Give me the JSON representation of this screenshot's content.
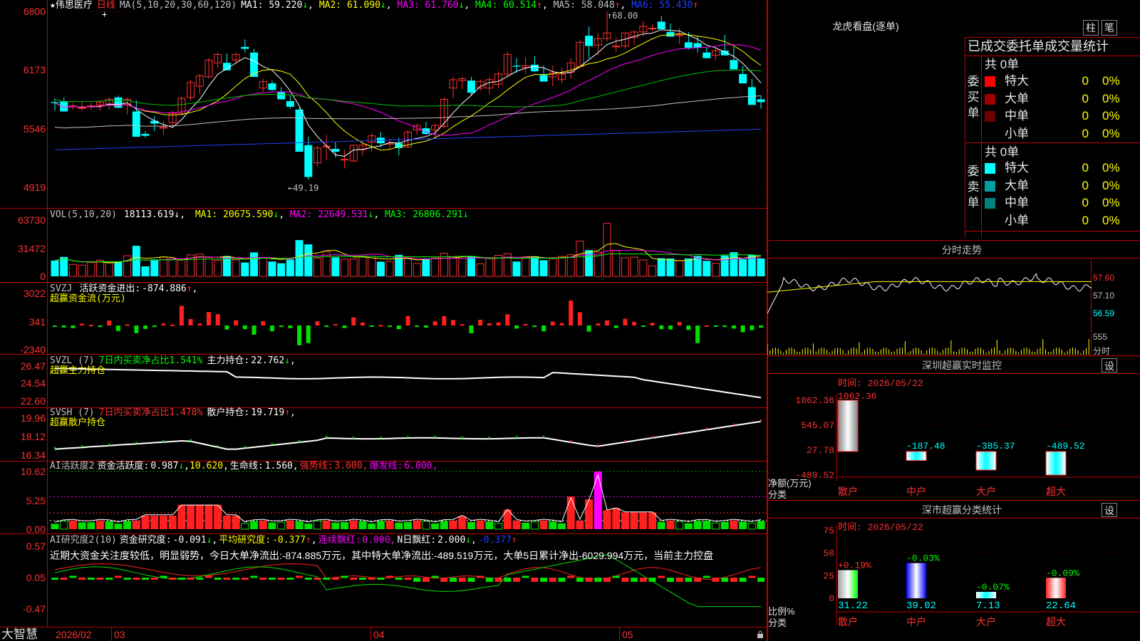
{
  "main": {
    "security": "★伟思医疗",
    "period": "日线",
    "ma_params": "MA(5,10,20,30,60,120)",
    "ma": [
      {
        "label": "MA1:",
        "value": "59.220",
        "arrow": "↓",
        "color": "#ffffff"
      },
      {
        "label": "MA2:",
        "value": "61.090",
        "arrow": "↓",
        "color": "#ffff00"
      },
      {
        "label": "MA3:",
        "value": "61.760",
        "arrow": "↓",
        "color": "#ff00ff"
      },
      {
        "label": "MA4:",
        "value": "60.514",
        "arrow": "↑",
        "color": "#00ff00"
      },
      {
        "label": "MA5:",
        "value": "58.048",
        "arrow": "↑",
        "color": "#c0c0c0"
      },
      {
        "label": "MA6:",
        "value": "55.430",
        "arrow": "↑",
        "color": "#2040ff"
      }
    ],
    "high_marker": "68.00",
    "low_marker": "49.19",
    "axis": [
      "6800",
      "6173",
      "5546",
      "4919"
    ],
    "date_axis": [
      "2026/02",
      "03",
      "04",
      "05"
    ],
    "logo": "大智慧"
  },
  "vol": {
    "legend": "VOL(5,10,20)",
    "value": "18113.619",
    "ma": [
      {
        "label": "MA1:",
        "value": "20675.590",
        "arrow": "↓",
        "color": "#ffff00"
      },
      {
        "label": "MA2:",
        "value": "22649.531",
        "arrow": "↓",
        "color": "#ff00ff"
      },
      {
        "label": "MA3:",
        "value": "26806.291",
        "arrow": "↓",
        "color": "#00ff00"
      }
    ],
    "axis": [
      "63730",
      "31472",
      "0"
    ]
  },
  "svzj": {
    "legend_name": "SVZJ",
    "legend_text": "活跃资金进出:",
    "legend_value": "-874.886",
    "legend_arrow": "↑",
    "subtitle": "超赢资金流(万元)",
    "axis": [
      "3022",
      "341",
      "-2340"
    ]
  },
  "svzl": {
    "legend_name": "SVZL (7)",
    "legend_ratio": "7日内买卖净占比1.541%",
    "legend_text": "主力持仓:",
    "legend_value": "22.762",
    "legend_arrow": "↓",
    "subtitle": "超赢主力持仓",
    "axis": [
      "26.47",
      "24.54",
      "22.60"
    ]
  },
  "svsh": {
    "legend_name": "SVSH (7)",
    "legend_ratio": "7日内买卖净占比1.478%",
    "legend_text": "散户持仓:",
    "legend_value": "19.719",
    "legend_arrow": "↑",
    "subtitle": "超赢散户持仓",
    "axis": [
      "19.96",
      "18.12",
      "16.34"
    ]
  },
  "ai_active": {
    "legend_name": "AI活跃度2",
    "legend_text": "资金活跃度:",
    "legend_value": "0.987",
    "legend_arrow": "↓",
    "legend_value2": "10.620",
    "life_label": "生命线:",
    "life_value": "1.560",
    "strong_label": "强势线:",
    "strong_value": "3.000",
    "burst_label": "爆发线:",
    "burst_value": "6.000",
    "axis": [
      "10.62",
      "5.25",
      "0.00"
    ]
  },
  "ai_research": {
    "legend_name": "AI研究度2(10)",
    "research_label": "资金研究度:",
    "research_value": "-0.091",
    "research_arrow": "↓",
    "avg_label": "平均研究度:",
    "avg_value": "-0.377",
    "avg_arrow": "↑",
    "red_label": "连续飘红:",
    "red_value": "0.000",
    "nred_label": "N日飘红:",
    "nred_value": "2.000",
    "nred_arrow": "↓",
    "last_value": "-0.377",
    "last_arrow": "↑",
    "comment": "近期大资金关注度较低，明显弱势，今日大单净流出:-874.885万元，其中特大单净流出:-489.519万元，大单5日累计净出-6029.994万元，当前主力控盘",
    "axis": [
      "0.57",
      "0.05",
      "-0.47"
    ]
  },
  "right": {
    "header_title": "龙虎看盘(逐单)",
    "btn_bar": "柱",
    "btn_pen": "笔",
    "stats_title": "已成交委托单成交量统计",
    "buy_side": "委买单",
    "sell_side": "委卖单",
    "buy_total": "共 0单",
    "sell_total": "共 0单",
    "buy_rows": [
      {
        "label": "特大",
        "count": "0",
        "pct": "0%",
        "color": "#ff0000"
      },
      {
        "label": "大单",
        "count": "0",
        "pct": "0%",
        "color": "#a00000"
      },
      {
        "label": "中单",
        "count": "0",
        "pct": "0%",
        "color": "#700000"
      },
      {
        "label": "小单",
        "count": "0",
        "pct": "0%",
        "color": ""
      }
    ],
    "sell_rows": [
      {
        "label": "特大",
        "count": "0",
        "pct": "0%",
        "color": "#00ffff"
      },
      {
        "label": "大单",
        "count": "0",
        "pct": "0%",
        "color": "#00a0a0"
      },
      {
        "label": "中单",
        "count": "0",
        "pct": "0%",
        "color": "#008080"
      },
      {
        "label": "小单",
        "count": "0",
        "pct": "0%",
        "color": ""
      }
    ],
    "intraday_title": "分时走势",
    "intraday_axis": [
      "57.60",
      "57.10",
      "56.59",
      "555",
      "分时"
    ],
    "sz_monitor_title": "深圳超赢实时监控",
    "set_label": "设",
    "sz_time": "时间: 2026/05/22",
    "sz_axis": [
      "1062.36",
      "545.07",
      "27.78",
      "-489.52"
    ],
    "sz_ylabel": "净额(万元)",
    "sz_xlabel": "分类",
    "sz_categories": [
      "散户",
      "中户",
      "大户",
      "超大"
    ],
    "sz_values": [
      {
        "label": "1062.36",
        "value": 1062.36
      },
      {
        "label": "-187.48",
        "value": -187.48
      },
      {
        "label": "-385.37",
        "value": -385.37
      },
      {
        "label": "-489.52",
        "value": -489.52
      }
    ],
    "class_title": "深市超赢分类统计",
    "class_time": "时间: 2026/05/22",
    "class_axis": [
      "75",
      "50",
      "25",
      "0"
    ],
    "class_ylabel": "比例%",
    "class_xlabel": "分类",
    "class_categories": [
      "散户",
      "中户",
      "大户",
      "超大"
    ],
    "class_values": [
      {
        "value": 31.22,
        "label": "31.22",
        "delta": "+0.19%"
      },
      {
        "value": 39.02,
        "label": "39.02",
        "delta": "-0.03%"
      },
      {
        "value": 7.13,
        "label": "7.13",
        "delta": "-0.07%"
      },
      {
        "value": 22.64,
        "label": "22.64",
        "delta": "-0.09%"
      }
    ]
  },
  "colors": {
    "up": "#ff3030",
    "down": "#00ffff",
    "grid": "#c00000"
  },
  "icons": {
    "lock": "lock-icon",
    "crosshair": "crosshair-icon"
  },
  "chart_data": {
    "type": "candlestick",
    "ylim": [
      49.19,
      68.0
    ],
    "candles": [
      [
        58.3,
        58.7,
        57.4,
        58.2
      ],
      [
        58.4,
        58.8,
        57.3,
        57.3
      ],
      [
        57.8,
        58.2,
        57.5,
        57.9
      ],
      [
        57.7,
        58.3,
        57.4,
        57.7
      ],
      [
        57.9,
        58.2,
        57.5,
        57.9
      ],
      [
        58.0,
        58.4,
        57.4,
        58.3
      ],
      [
        58.1,
        58.8,
        57.5,
        58.6
      ],
      [
        58.8,
        59.0,
        57.6,
        57.7
      ],
      [
        58.0,
        58.8,
        57.0,
        58.6
      ],
      [
        57.3,
        58.5,
        54.6,
        54.6
      ],
      [
        54.9,
        55.2,
        54.5,
        54.7
      ],
      [
        56.3,
        56.8,
        55.2,
        56.0
      ],
      [
        55.6,
        56.3,
        54.8,
        55.6
      ],
      [
        56.1,
        57.4,
        55.7,
        57.1
      ],
      [
        57.1,
        58.9,
        56.9,
        58.7
      ],
      [
        58.8,
        60.7,
        58.5,
        60.4
      ],
      [
        60.0,
        61.3,
        59.2,
        61.1
      ],
      [
        61.0,
        63.0,
        60.8,
        62.8
      ],
      [
        62.5,
        63.6,
        61.9,
        63.4
      ],
      [
        62.5,
        63.5,
        61.7,
        61.7
      ],
      [
        62.8,
        63.6,
        62.4,
        63.4
      ],
      [
        64.2,
        65.0,
        63.6,
        64.0
      ],
      [
        63.6,
        64.0,
        61.0,
        61.0
      ],
      [
        59.8,
        60.8,
        59.4,
        60.5
      ],
      [
        60.3,
        60.6,
        59.5,
        59.6
      ],
      [
        59.4,
        59.9,
        58.6,
        58.6
      ],
      [
        58.4,
        59.0,
        57.6,
        57.8
      ],
      [
        57.5,
        57.7,
        53.0,
        53.0
      ],
      [
        53.7,
        54.6,
        50.0,
        50.3
      ],
      [
        51.8,
        53.6,
        51.4,
        53.4
      ],
      [
        53.6,
        54.8,
        52.1,
        53.6
      ],
      [
        53.3,
        54.0,
        52.4,
        53.0
      ],
      [
        52.1,
        53.2,
        51.2,
        52.2
      ],
      [
        52.0,
        53.7,
        51.9,
        53.7
      ],
      [
        53.2,
        54.1,
        52.6,
        53.7
      ],
      [
        54.0,
        55.0,
        53.0,
        54.7
      ],
      [
        54.5,
        55.1,
        53.5,
        53.9
      ],
      [
        53.8,
        54.4,
        53.3,
        53.9
      ],
      [
        53.9,
        54.5,
        52.6,
        53.4
      ],
      [
        53.5,
        55.3,
        53.4,
        55.1
      ],
      [
        55.3,
        56.0,
        54.8,
        55.8
      ],
      [
        55.5,
        56.2,
        54.8,
        54.9
      ],
      [
        55.3,
        56.0,
        54.4,
        55.8
      ],
      [
        55.7,
        58.8,
        55.5,
        58.6
      ],
      [
        59.8,
        61.0,
        58.7,
        60.7
      ],
      [
        60.6,
        61.0,
        59.7,
        60.8
      ],
      [
        60.6,
        61.0,
        59.0,
        59.3
      ],
      [
        59.8,
        60.7,
        59.5,
        60.5
      ],
      [
        59.8,
        61.0,
        59.1,
        60.7
      ],
      [
        60.2,
        61.6,
        59.8,
        61.3
      ],
      [
        61.3,
        63.7,
        61.0,
        63.4
      ],
      [
        62.2,
        63.0,
        61.4,
        62.1
      ],
      [
        62.0,
        63.1,
        61.3,
        62.2
      ],
      [
        62.3,
        63.2,
        61.5,
        61.6
      ],
      [
        61.2,
        62.2,
        60.5,
        60.5
      ],
      [
        61.0,
        62.2,
        60.0,
        61.4
      ],
      [
        60.7,
        62.0,
        60.3,
        61.3
      ],
      [
        61.5,
        63.0,
        60.8,
        62.5
      ],
      [
        62.1,
        64.9,
        61.9,
        64.7
      ],
      [
        65.4,
        66.4,
        63.0,
        64.3
      ],
      [
        64.4,
        65.7,
        63.3,
        65.1
      ],
      [
        65.1,
        68.0,
        64.8,
        65.7
      ],
      [
        64.2,
        65.2,
        63.7,
        64.3
      ],
      [
        64.3,
        65.7,
        64.0,
        65.7
      ],
      [
        65.2,
        66.0,
        64.5,
        65.8
      ],
      [
        65.8,
        67.0,
        65.3,
        66.4
      ],
      [
        66.2,
        66.6,
        65.9,
        66.2
      ],
      [
        66.9,
        67.5,
        66.1,
        66.1
      ],
      [
        65.8,
        66.7,
        65.3,
        65.3
      ],
      [
        65.4,
        66.2,
        64.5,
        65.5
      ],
      [
        64.7,
        65.8,
        63.9,
        64.1
      ],
      [
        64.6,
        65.3,
        63.6,
        64.1
      ],
      [
        63.6,
        64.2,
        63.0,
        63.0
      ],
      [
        63.3,
        64.1,
        62.8,
        63.8
      ],
      [
        63.8,
        65.5,
        63.3,
        63.3
      ],
      [
        62.8,
        64.2,
        61.8,
        61.8
      ],
      [
        61.3,
        62.2,
        60.4,
        60.3
      ],
      [
        59.9,
        60.8,
        58.0,
        58.0
      ],
      [
        58.6,
        59.0,
        57.6,
        58.3
      ]
    ],
    "volume_ylim": [
      0,
      63730
    ],
    "svzj_ylim": [
      -2340,
      3022
    ],
    "svzl_ylim": [
      22.6,
      26.47
    ],
    "svsh_ylim": [
      16.34,
      19.96
    ],
    "ai_ylim": [
      0,
      10.62
    ],
    "research_ylim": [
      -0.47,
      0.57
    ]
  }
}
